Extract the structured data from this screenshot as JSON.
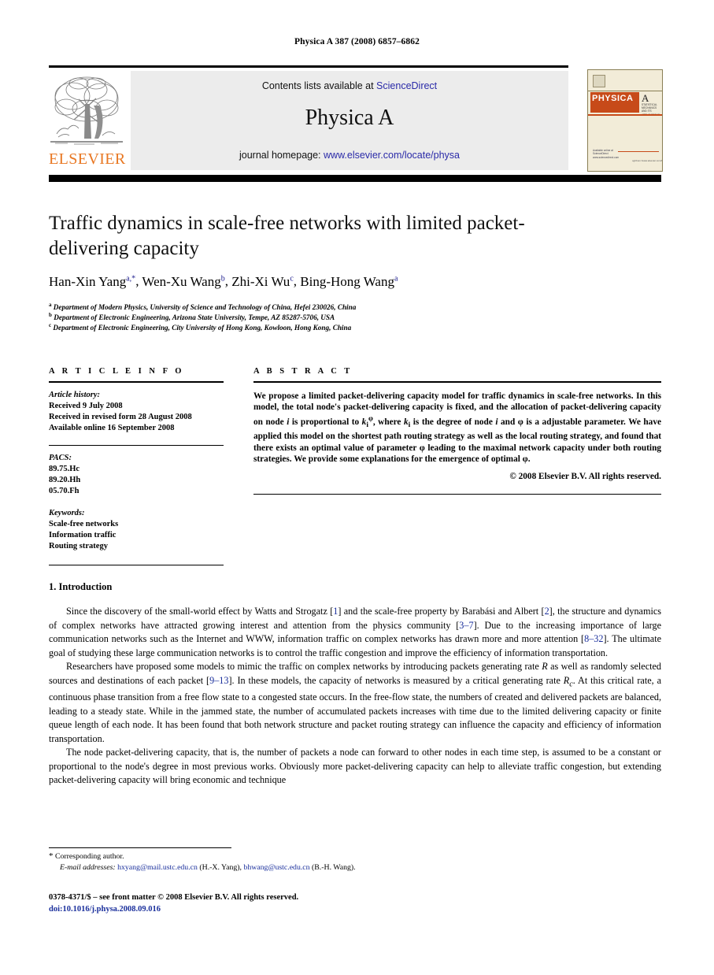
{
  "running_head": "Physica A 387 (2008) 6857–6862",
  "header": {
    "contents_prefix": "Contents lists available at ",
    "sciencedirect": "ScienceDirect",
    "journal_title": "Physica A",
    "homepage_prefix": "journal homepage: ",
    "homepage_url": "www.elsevier.com/locate/physa",
    "publisher": "ELSEVIER",
    "accent_orange": "#E87722",
    "link_blue": "#2a2aa8"
  },
  "cover": {
    "masthead": "PHYSICA",
    "volume_letter": "A",
    "subtitle": "STATISTICAL MECHANICS AND ITS APPLICATIONS",
    "available_online": "Available online at",
    "sciencedirect": "ScienceDirect",
    "sciencedirect_url": "www.sciencedirect.com",
    "footer_note": "ogtrbom:/www.elsevier.com/locate/physa",
    "band_color": "#c74a19",
    "paper_color": "#f2ecd8"
  },
  "article": {
    "title": "Traffic dynamics in scale-free networks with limited packet-delivering capacity",
    "authors": [
      {
        "name": "Han-Xin Yang",
        "marks": "a,*"
      },
      {
        "name": "Wen-Xu Wang",
        "marks": "b"
      },
      {
        "name": "Zhi-Xi Wu",
        "marks": "c"
      },
      {
        "name": "Bing-Hong Wang",
        "marks": "a"
      }
    ],
    "affiliations": [
      {
        "mark": "a",
        "text": "Department of Modern Physics, University of Science and Technology of China, Hefei 230026, China"
      },
      {
        "mark": "b",
        "text": "Department of Electronic Engineering, Arizona State University, Tempe, AZ 85287-5706, USA"
      },
      {
        "mark": "c",
        "text": "Department of Electronic Engineering, City University of Hong Kong, Kowloon, Hong Kong, China"
      }
    ]
  },
  "info": {
    "heading": "A R T I C L E   I N F O",
    "history_label": "Article history:",
    "history": [
      "Received 9 July 2008",
      "Received in revised form 28 August 2008",
      "Available online 16 September 2008"
    ],
    "pacs_label": "PACS:",
    "pacs": [
      "89.75.Hc",
      "89.20.Hh",
      "05.70.Fh"
    ],
    "keywords_label": "Keywords:",
    "keywords": [
      "Scale-free networks",
      "Information traffic",
      "Routing strategy"
    ]
  },
  "abstract": {
    "heading": "A B S T R A C T",
    "part1": "We propose a limited packet-delivering capacity model for traffic dynamics in scale-free networks. In this model, the total node's packet-delivering capacity is fixed, and the allocation of packet-delivering capacity on node ",
    "node_i": "i",
    "part2": " is proportional to ",
    "k_base": "k",
    "k_sub": "i",
    "k_sup": "φ",
    "part3": ", where ",
    "k_base2": "k",
    "k_sub2": "i",
    "part4": " is the degree of node ",
    "node_i2": "i",
    "part5": " and φ is a adjustable parameter. We have applied this model on the shortest path routing strategy as well as the local routing strategy, and found that there exists an optimal value of parameter φ leading to the maximal network capacity under both routing strategies. We provide some explanations for the emergence of optimal φ.",
    "copyright": "© 2008 Elsevier B.V. All rights reserved."
  },
  "body": {
    "section_title": "1.  Introduction",
    "paragraphs": [
      {
        "segments": [
          {
            "t": "Since the discovery of the small-world effect by Watts and Strogatz [",
            "k": "plain"
          },
          {
            "t": "1",
            "k": "ref"
          },
          {
            "t": "] and the scale-free property by Barabási and Albert [",
            "k": "plain"
          },
          {
            "t": "2",
            "k": "ref"
          },
          {
            "t": "], the structure and dynamics of complex networks have attracted growing interest and attention from the physics community [",
            "k": "plain"
          },
          {
            "t": "3–7",
            "k": "ref"
          },
          {
            "t": "]. Due to the increasing importance of large communication networks such as the Internet and WWW, information traffic on complex networks has drawn more and more attention [",
            "k": "plain"
          },
          {
            "t": "8–32",
            "k": "ref"
          },
          {
            "t": "]. The ultimate goal of studying these large communication networks is to control the traffic congestion and improve the efficiency of information transportation.",
            "k": "plain"
          }
        ]
      },
      {
        "segments": [
          {
            "t": "Researchers have proposed some models to mimic the traffic on complex networks by introducing packets generating rate ",
            "k": "plain"
          },
          {
            "t": "R",
            "k": "italic"
          },
          {
            "t": " as well as randomly selected sources and destinations of each packet [",
            "k": "plain"
          },
          {
            "t": "9–13",
            "k": "ref"
          },
          {
            "t": "]. In these models, the capacity of networks is measured by a critical generating rate ",
            "k": "plain"
          },
          {
            "t": "R",
            "k": "italic"
          },
          {
            "t": "c",
            "k": "sub-italic"
          },
          {
            "t": ". At this critical rate, a continuous phase transition from a free flow state to a congested state occurs. In the free-flow state, the numbers of created and delivered packets are balanced, leading to a steady state. While in the jammed state, the number of accumulated packets increases with time due to the limited delivering capacity or finite queue length of each node. It has been found that both network structure and packet routing strategy can influence the capacity and efficiency of information transportation.",
            "k": "plain"
          }
        ]
      },
      {
        "segments": [
          {
            "t": "The node packet-delivering capacity, that is, the number of packets a node can forward to other nodes in each time step, is assumed to be a constant or proportional to the node's degree in most previous works. Obviously more packet-delivering capacity can help to alleviate traffic congestion, but extending packet-delivering capacity will bring economic and technique",
            "k": "plain"
          }
        ]
      }
    ]
  },
  "footer": {
    "corresponding_mark": "*",
    "corresponding_text": "Corresponding author.",
    "email_label": "E-mail addresses:",
    "email1": "hxyang@mail.ustc.edu.cn",
    "email1_who": " (H.-X. Yang),",
    "email2": "bhwang@ustc.edu.cn",
    "email2_who": " (B.-H. Wang).",
    "issn_line": "0378-4371/$ – see front matter © 2008 Elsevier B.V. All rights reserved.",
    "doi": "doi:10.1016/j.physa.2008.09.016"
  }
}
